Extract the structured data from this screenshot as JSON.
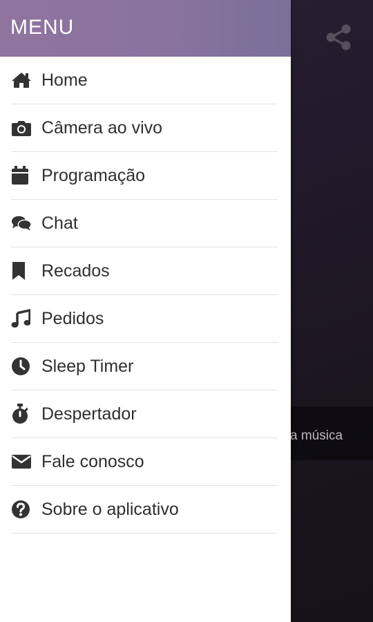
{
  "drawer": {
    "title": "MENU",
    "items": [
      {
        "label": "Home",
        "icon": "home-icon"
      },
      {
        "label": "Câmera ao vivo",
        "icon": "camera-icon"
      },
      {
        "label": "Programação",
        "icon": "calendar-icon"
      },
      {
        "label": "Chat",
        "icon": "chat-icon"
      },
      {
        "label": "Recados",
        "icon": "bookmark-icon"
      },
      {
        "label": "Pedidos",
        "icon": "music-note-icon"
      },
      {
        "label": "Sleep Timer",
        "icon": "clock-icon"
      },
      {
        "label": "Despertador",
        "icon": "stopwatch-icon"
      },
      {
        "label": "Fale conosco",
        "icon": "envelope-icon"
      },
      {
        "label": "Sobre o aplicativo",
        "icon": "question-circle-icon"
      }
    ]
  },
  "background": {
    "share_icon": "share-icon",
    "song_text": "a música"
  },
  "colors": {
    "header": "#8a749f",
    "text": "#2f2f2f",
    "icon": "#333333"
  }
}
